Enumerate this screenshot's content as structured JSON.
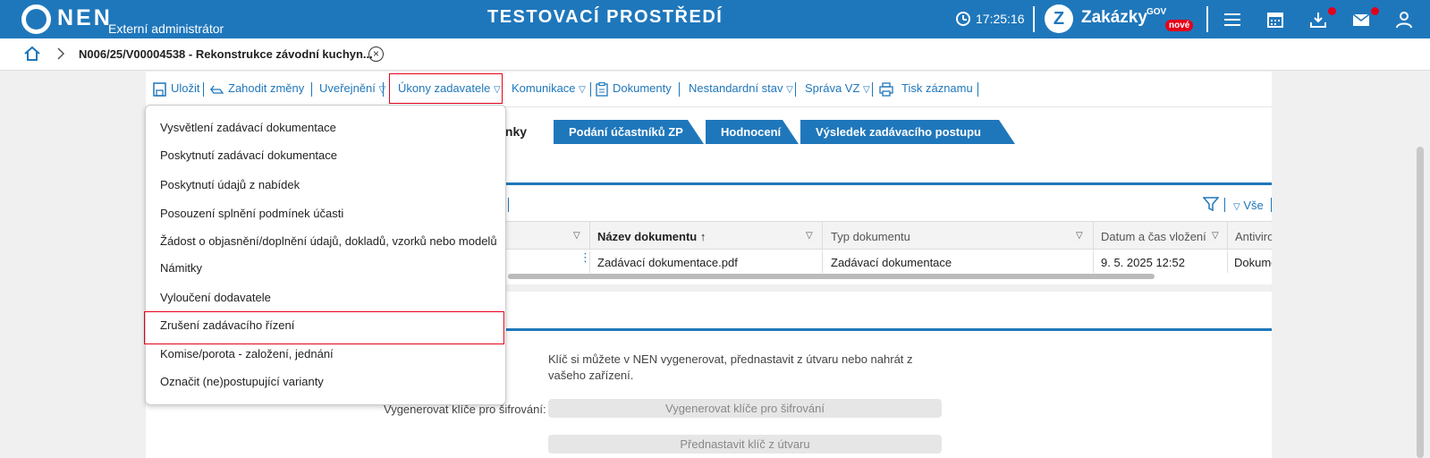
{
  "topbar": {
    "brand": "NEN",
    "role": "Externí administrátor",
    "environment": "TESTOVACÍ PROSTŘEDÍ",
    "time": "17:25:16",
    "zakazky": {
      "name": "Zakázky",
      "sup": "GOV",
      "badge": "nové"
    },
    "icons": [
      "menu-icon",
      "calendar-icon",
      "download-icon",
      "mail-icon",
      "user-icon"
    ],
    "accent_color": "#1f77bb",
    "alert_color": "#e3001b"
  },
  "breadcrumb": {
    "text": "N006/25/V00004538 - Rekonstrukce závodní kuchyn..."
  },
  "toolbar": {
    "items": [
      {
        "label": "Uložit",
        "icon": "save-icon"
      },
      {
        "label": "Zahodit změny",
        "icon": "undo-icon"
      },
      {
        "label": "Uveřejnění",
        "has_dropdown": true
      },
      {
        "label": "Úkony zadavatele",
        "has_dropdown": true
      },
      {
        "label": "Komunikace",
        "has_dropdown": true
      },
      {
        "label": "Dokumenty",
        "icon": "document-icon"
      },
      {
        "label": "Nestandardní stav",
        "has_dropdown": true
      },
      {
        "label": "Správa VZ",
        "has_dropdown": true
      },
      {
        "label": "Tisk záznamu",
        "icon": "print-icon"
      }
    ]
  },
  "tabs": {
    "active_fragment": "ínky",
    "items": [
      "Podání účastníků ZP",
      "Hodnocení",
      "Výsledek zadávacího postupu"
    ]
  },
  "filter_bar": {
    "all_label": "Vše"
  },
  "table": {
    "columns": [
      "Název dokumentu",
      "Typ dokumentu",
      "Datum a čas vložení",
      "Antiviro"
    ],
    "rows": [
      {
        "name": "Zadávací dokumentace.pdf",
        "type": "Zadávací dokumentace",
        "date": "9. 5. 2025 12:52",
        "antivirus": "Dokume"
      }
    ]
  },
  "form": {
    "note": "Klíč si můžete v NEN vygenerovat, přednastavit z útvaru nebo nahrát z vašeho zařízení.",
    "label": "Vygenerovat klíče pro šifrování:",
    "button_generate": "Vygenerovat klíče pro šifrování",
    "button_preset": "Přednastavit klíč z útvaru"
  },
  "menu": {
    "items": [
      "Vysvětlení zadávací dokumentace",
      "Poskytnutí zadávací dokumentace",
      "Poskytnutí údajů z nabídek",
      "Posouzení splnění podmínek účasti",
      "Žádost o objasnění/doplnění údajů, dokladů, vzorků nebo modelů",
      "Námitky",
      "Vyloučení dodavatele",
      "Zrušení zadávacího řízení",
      "Komise/porota - založení, jednání",
      "Označit (ne)postupující varianty"
    ]
  }
}
